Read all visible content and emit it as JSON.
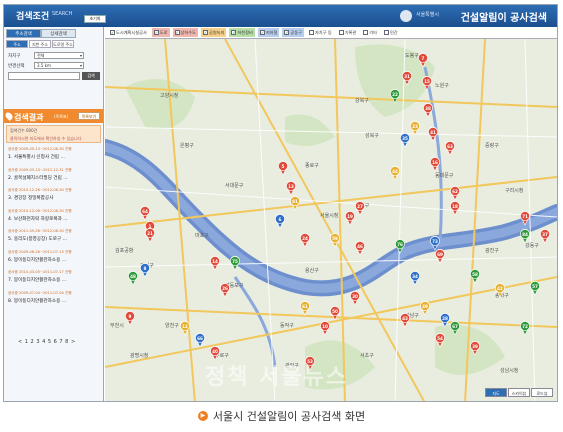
{
  "header": {
    "title": "검색조건",
    "search_tab": "SEARCH",
    "reset_label": "초기화",
    "brand_org": "서울특별시",
    "brand_title": "건설알림이 공사검색"
  },
  "sidebar": {
    "tabs": [
      {
        "label": "주소검색"
      },
      {
        "label": "상세검색"
      }
    ],
    "subtabs": [
      {
        "label": "주소"
      },
      {
        "label": "지번 주소"
      },
      {
        "label": "도로명 주소"
      }
    ],
    "district_label": "자치구",
    "district_value": "전체",
    "radius_label": "반경선택",
    "radius_value": "3.5 km",
    "search_button": "검색"
  },
  "results": {
    "title": "검색결과",
    "subtitle": "(목록표)",
    "list_button": "목록보기",
    "notice_line1": "검색건수 000건",
    "notice_line2": "클릭하시면 지도에서 확인하실 수 있습니다.",
    "items": [
      {
        "meta": "공사중 2009-05-13~2012-06-30 진행",
        "name": "1. 서울특별시 신청사 건립 ..."
      },
      {
        "meta": "공사중 2009-03-13~2012-12-31 진행",
        "name": "2. 골목설폐지스터필딩 건립 ..."
      },
      {
        "meta": "공사중 2010-12-26~2012-06-30 진행",
        "name": "3. 경강장 정밀복합공사"
      },
      {
        "meta": "공사중 2010-12-06~2012-06-30 진행",
        "name": "4. 보산화천자락 자랑로복과 ..."
      },
      {
        "meta": "공사중 2011-09-26~2012-06-30 진행",
        "name": "5. 용리도(봉영공장) 도로구 ..."
      },
      {
        "meta": "공사중 2009-06-26~2011-07-15 진행",
        "name": "6. 봉이동디지안활관자소용 ..."
      },
      {
        "meta": "공사중 2010-03-05~2011-07-17 진행",
        "name": "7. 봉이동디지안활관자소용 ..."
      },
      {
        "meta": "공사중 2009-07-04~2011-07-04 진행",
        "name": "8. 봉이동디지안활관자소용 ..."
      }
    ],
    "pager": "< 1 2 3 4 5 6 7 8 >"
  },
  "map": {
    "filters": [
      {
        "label": "도시계획시설공사",
        "checked": true
      },
      {
        "label": "도로",
        "checked": true
      },
      {
        "label": "상하수도",
        "checked": true
      },
      {
        "label": "공원녹지",
        "checked": true
      },
      {
        "label": "하천정비",
        "checked": true
      },
      {
        "label": "지하철",
        "checked": true
      },
      {
        "label": "공동구",
        "checked": true
      },
      {
        "label": "자치구 등",
        "checked": false
      },
      {
        "label": "기록관",
        "checked": false
      },
      {
        "label": "기타",
        "checked": false
      },
      {
        "label": "민간",
        "checked": false
      }
    ],
    "labels": [
      {
        "t": "고양시청"
      },
      {
        "t": "도봉구"
      },
      {
        "t": "노원구"
      },
      {
        "t": "강북구"
      },
      {
        "t": "성북구"
      },
      {
        "t": "은평구"
      },
      {
        "t": "서대문구"
      },
      {
        "t": "종로구"
      },
      {
        "t": "중랑구"
      },
      {
        "t": "동대문구"
      },
      {
        "t": "마포구"
      },
      {
        "t": "서울시청"
      },
      {
        "t": "중구"
      },
      {
        "t": "구리시청"
      },
      {
        "t": "광진구"
      },
      {
        "t": "용산구"
      },
      {
        "t": "강서구"
      },
      {
        "t": "양천구"
      },
      {
        "t": "영등포구"
      },
      {
        "t": "동작구"
      },
      {
        "t": "강남구"
      },
      {
        "t": "송파구"
      },
      {
        "t": "구로구"
      },
      {
        "t": "관악구"
      },
      {
        "t": "서초구"
      },
      {
        "t": "광명시청"
      },
      {
        "t": "강동구"
      },
      {
        "t": "성남시청"
      },
      {
        "t": "김포공항"
      },
      {
        "t": "부천시"
      }
    ],
    "markers": [
      {
        "n": "7",
        "c": "#e04a3a"
      },
      {
        "n": "15",
        "c": "#e04a3a"
      },
      {
        "n": "31",
        "c": "#e04a3a"
      },
      {
        "n": "22",
        "c": "#2f9a3a"
      },
      {
        "n": "38",
        "c": "#e04a3a"
      },
      {
        "n": "23",
        "c": "#e8b030"
      },
      {
        "n": "35",
        "c": "#2f6fc8"
      },
      {
        "n": "41",
        "c": "#e04a3a"
      },
      {
        "n": "63",
        "c": "#e04a3a"
      },
      {
        "n": "16",
        "c": "#e04a3a"
      },
      {
        "n": "44",
        "c": "#e8b030"
      },
      {
        "n": "62",
        "c": "#e04a3a"
      },
      {
        "n": "18",
        "c": "#e04a3a"
      },
      {
        "n": "5",
        "c": "#e04a3a"
      },
      {
        "n": "13",
        "c": "#e04a3a"
      },
      {
        "n": "81",
        "c": "#e8b030"
      },
      {
        "n": "64",
        "c": "#e04a3a"
      },
      {
        "n": "1",
        "c": "#e04a3a"
      },
      {
        "n": "21",
        "c": "#e04a3a"
      },
      {
        "n": "6",
        "c": "#2f6fc8"
      },
      {
        "n": "19",
        "c": "#e04a3a"
      },
      {
        "n": "27",
        "c": "#e04a3a"
      },
      {
        "n": "59",
        "c": "#e8b030"
      },
      {
        "n": "24",
        "c": "#e04a3a"
      },
      {
        "n": "46",
        "c": "#e04a3a"
      },
      {
        "n": "76",
        "c": "#2f9a3a"
      },
      {
        "n": "69",
        "c": "#e04a3a"
      },
      {
        "n": "75",
        "c": "#2f9a3a"
      },
      {
        "n": "14",
        "c": "#e04a3a"
      },
      {
        "n": "26",
        "c": "#e04a3a"
      },
      {
        "n": "73",
        "c": "#2f6fc8"
      },
      {
        "n": "58",
        "c": "#2f9a3a"
      },
      {
        "n": "34",
        "c": "#2f6fc8"
      },
      {
        "n": "48",
        "c": "#2f9a3a"
      },
      {
        "n": "8",
        "c": "#2f6fc8"
      },
      {
        "n": "71",
        "c": "#e04a3a"
      },
      {
        "n": "84",
        "c": "#2f9a3a"
      },
      {
        "n": "37",
        "c": "#e04a3a"
      },
      {
        "n": "42",
        "c": "#e8b030"
      },
      {
        "n": "57",
        "c": "#2f9a3a"
      },
      {
        "n": "30",
        "c": "#e04a3a"
      },
      {
        "n": "50",
        "c": "#e04a3a"
      },
      {
        "n": "49",
        "c": "#e8b030"
      },
      {
        "n": "43",
        "c": "#e04a3a"
      },
      {
        "n": "28",
        "c": "#2f6fc8"
      },
      {
        "n": "67",
        "c": "#2f9a3a"
      },
      {
        "n": "54",
        "c": "#e04a3a"
      },
      {
        "n": "39",
        "c": "#e04a3a"
      },
      {
        "n": "72",
        "c": "#2f9a3a"
      },
      {
        "n": "12",
        "c": "#e8b030"
      },
      {
        "n": "9",
        "c": "#e04a3a"
      },
      {
        "n": "66",
        "c": "#2f6fc8"
      },
      {
        "n": "40",
        "c": "#e04a3a"
      },
      {
        "n": "53",
        "c": "#e04a3a"
      },
      {
        "n": "10",
        "c": "#e04a3a"
      },
      {
        "n": "61",
        "c": "#e8b030"
      }
    ],
    "watermark": "정책 서울뉴스",
    "view_buttons": [
      {
        "label": "지도"
      },
      {
        "label": "스카이뷰"
      },
      {
        "label": "로드뷰"
      }
    ]
  },
  "caption": "서울시 건설알림이 공사검색 화면"
}
